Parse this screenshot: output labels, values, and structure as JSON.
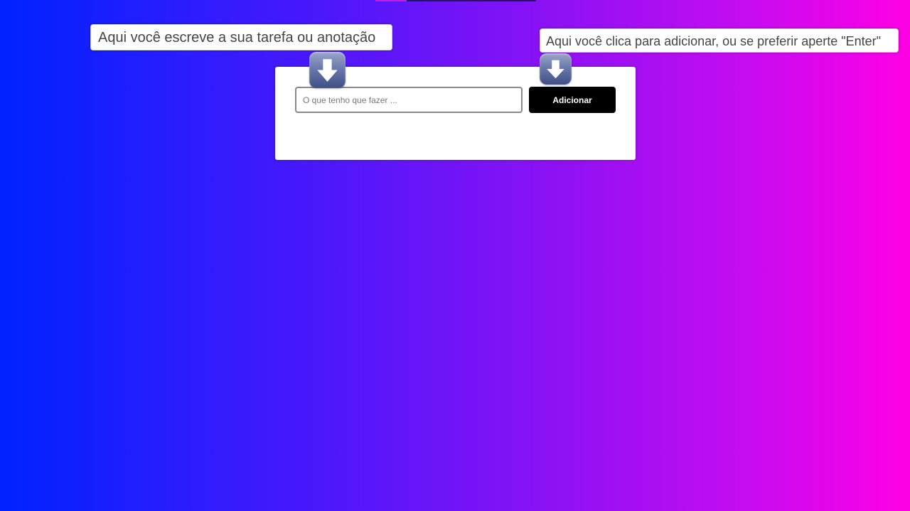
{
  "hints": {
    "input_hint": "Aqui você escreve a sua tarefa ou anotação",
    "button_hint": "Aqui você clica para adicionar, ou se preferir aperte \"Enter\""
  },
  "icons": {
    "input_arrow": "arrow-down-icon",
    "button_arrow": "arrow-down-icon"
  },
  "form": {
    "input_value": "",
    "input_placeholder": "O que tenho que fazer ...",
    "add_label": "Adicionar"
  },
  "colors": {
    "gradient_start": "#0022ff",
    "gradient_end": "#ff00e4",
    "button_bg": "#000000",
    "card_bg": "#ffffff"
  }
}
